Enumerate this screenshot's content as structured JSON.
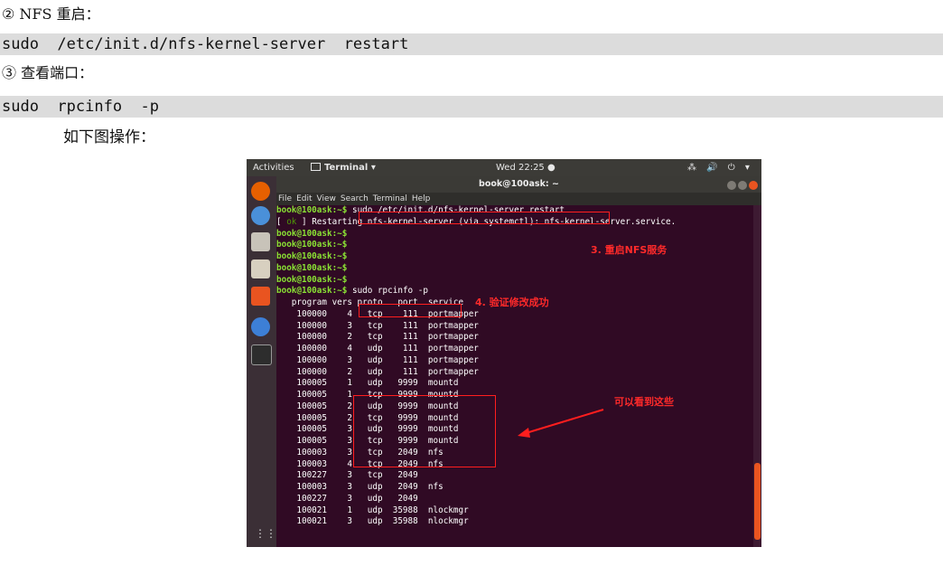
{
  "doc": {
    "step2_heading": "② NFS 重启：",
    "step2_command": "sudo  /etc/init.d/nfs-kernel-server  restart",
    "step3_heading": "③ 查看端口：",
    "step3_command": "sudo  rpcinfo  -p",
    "caption": "如下图操作："
  },
  "screenshot": {
    "topbar": {
      "activities": "Activities",
      "app_menu": "Terminal ▾",
      "clock": "Wed 22:25 ●",
      "tray": "⁂ 🔊 ⏻ ▾"
    },
    "window_title": "book@100ask: ~",
    "menu": [
      "File",
      "Edit",
      "View",
      "Search",
      "Terminal",
      "Help"
    ],
    "prompt": "book@100ask:~$",
    "lines": {
      "l1_cmd": " sudo /etc/init.d/nfs-kernel-server restart",
      "l2_open": "[ ",
      "l2_ok": "ok",
      "l2_rest": " ] Restarting nfs-kernel-server (via systemctl): nfs-kernel-server.service.",
      "l8_cmd": " sudo rpcinfo -p",
      "header": "   program vers proto   port  service"
    },
    "rpc_rows": [
      "    100000    4   tcp    111  portmapper",
      "    100000    3   tcp    111  portmapper",
      "    100000    2   tcp    111  portmapper",
      "    100000    4   udp    111  portmapper",
      "    100000    3   udp    111  portmapper",
      "    100000    2   udp    111  portmapper",
      "    100005    1   udp   9999  mountd",
      "    100005    1   tcp   9999  mountd",
      "    100005    2   udp   9999  mountd",
      "    100005    2   tcp   9999  mountd",
      "    100005    3   udp   9999  mountd",
      "    100005    3   tcp   9999  mountd",
      "    100003    3   tcp   2049  nfs",
      "    100003    4   tcp   2049  nfs",
      "    100227    3   tcp   2049",
      "    100003    3   udp   2049  nfs",
      "    100227    3   udp   2049",
      "    100021    1   udp  35988  nlockmgr",
      "    100021    3   udp  35988  nlockmgr"
    ],
    "annotations": {
      "restart_nfs": "3. 重启NFS服务",
      "verify": "4. 验证修改成功",
      "can_see": "可以看到这些"
    },
    "colors": {
      "terminal_bg": "#300a24",
      "prompt_green": "#8ae234",
      "highlight_red": "#ff1e1e",
      "accent_orange": "#e95420"
    }
  }
}
